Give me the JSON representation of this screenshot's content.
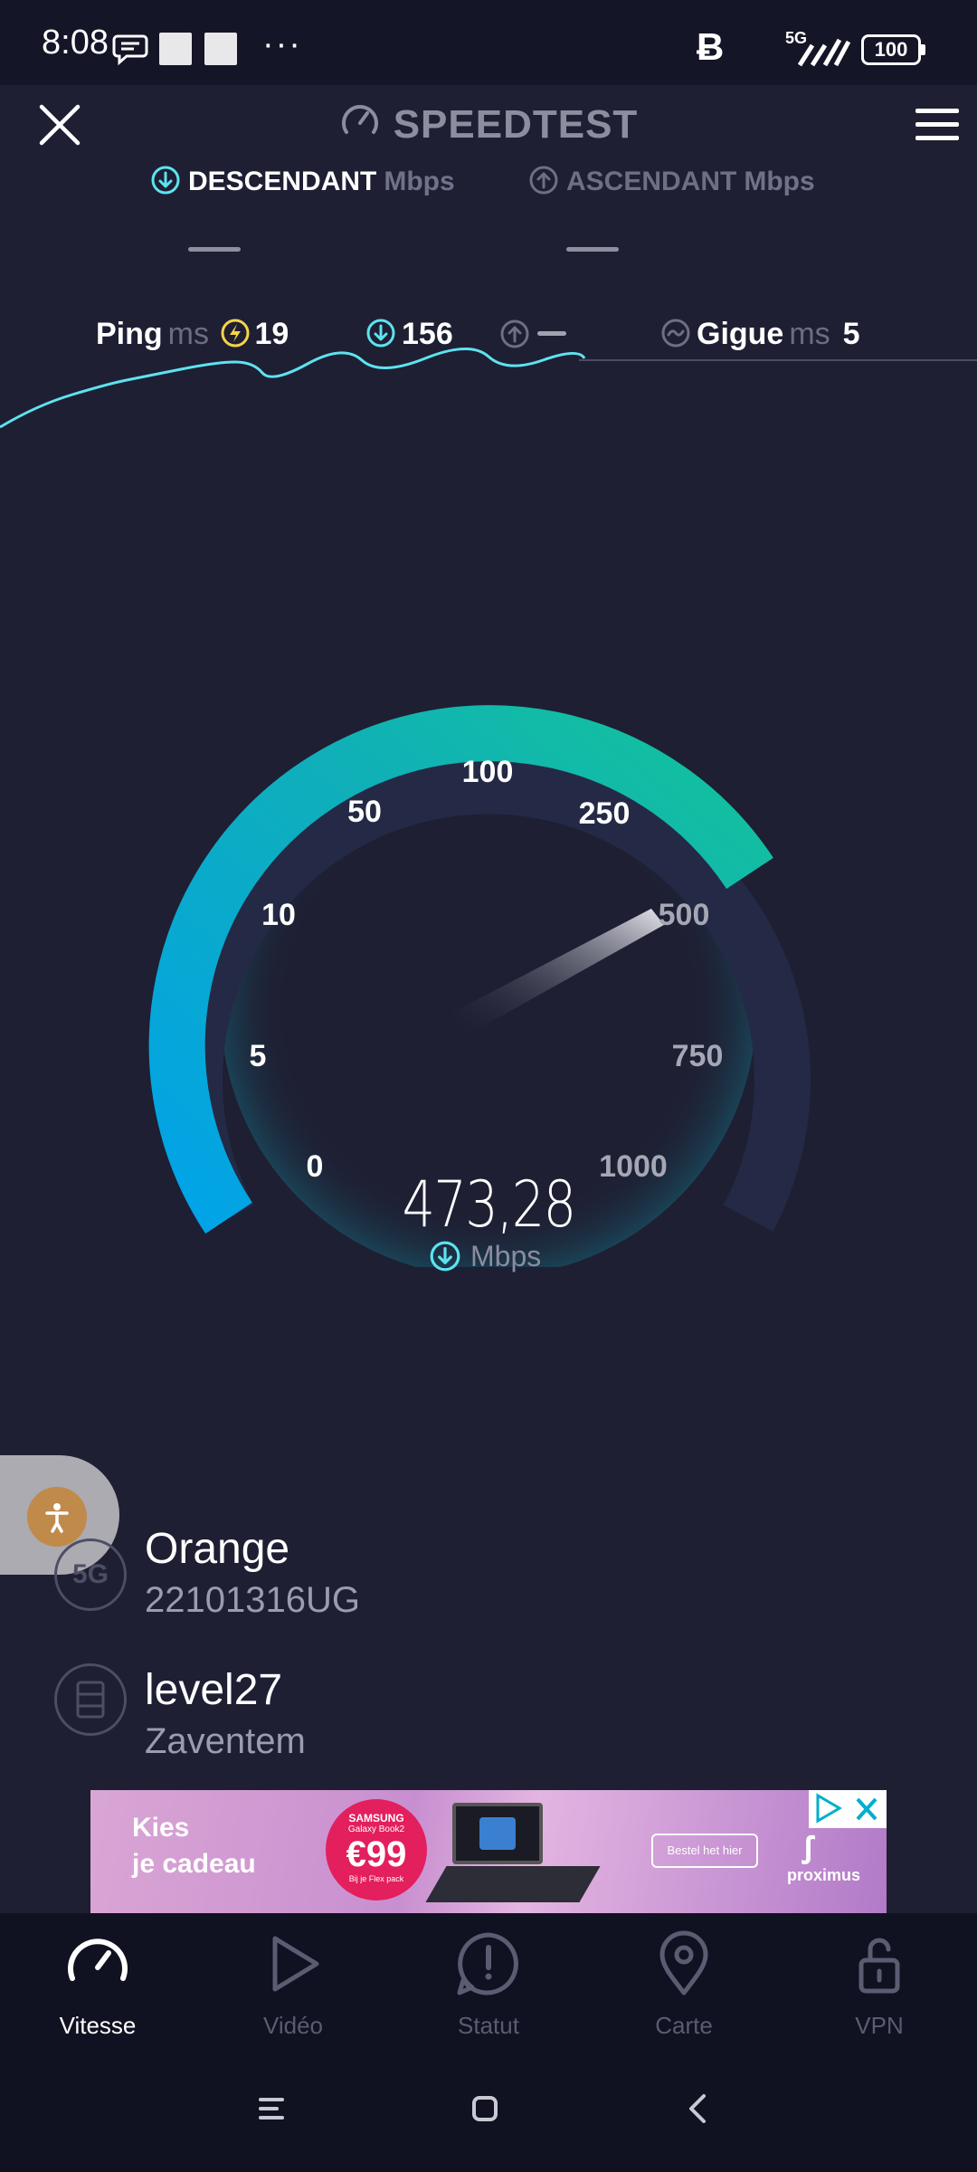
{
  "status_bar": {
    "time": "8:08",
    "network": "5G",
    "battery": "100"
  },
  "header": {
    "title": "SPEEDTEST"
  },
  "tabs": [
    {
      "label": "DESCENDANT",
      "unit": "Mbps",
      "active": true
    },
    {
      "label": "ASCENDANT",
      "unit": "Mbps",
      "active": false
    }
  ],
  "stats": {
    "ping_label": "Ping",
    "ping_unit": "ms",
    "ping_value": "19",
    "download_value": "156",
    "jitter_label": "Gigue",
    "jitter_unit": "ms",
    "jitter_value": "5"
  },
  "gauge": {
    "ticks": [
      "0",
      "5",
      "10",
      "50",
      "100",
      "250",
      "500",
      "750",
      "1000"
    ],
    "speed": "473,28",
    "unit": "Mbps",
    "accent_start": "#00a3e8",
    "accent_end": "#13c39a"
  },
  "provider": {
    "network_badge": "5G",
    "name": "Orange",
    "device": "22101316UG"
  },
  "server": {
    "name": "level27",
    "location": "Zaventem"
  },
  "ad": {
    "headline_1": "Kies",
    "headline_2": "je cadeau",
    "brand_small": "SAMSUNG",
    "product": "Galaxy Book2",
    "price": "€99",
    "price_note": "Bij je Flex pack",
    "cta": "Bestel het hier",
    "advertiser": "proximus"
  },
  "bottom_nav": [
    {
      "label": "Vitesse",
      "icon": "speedometer-icon",
      "active": true
    },
    {
      "label": "Vidéo",
      "icon": "play-icon",
      "active": false
    },
    {
      "label": "Statut",
      "icon": "alert-icon",
      "active": false
    },
    {
      "label": "Carte",
      "icon": "map-pin-icon",
      "active": false
    },
    {
      "label": "VPN",
      "icon": "unlock-icon",
      "active": false
    }
  ]
}
